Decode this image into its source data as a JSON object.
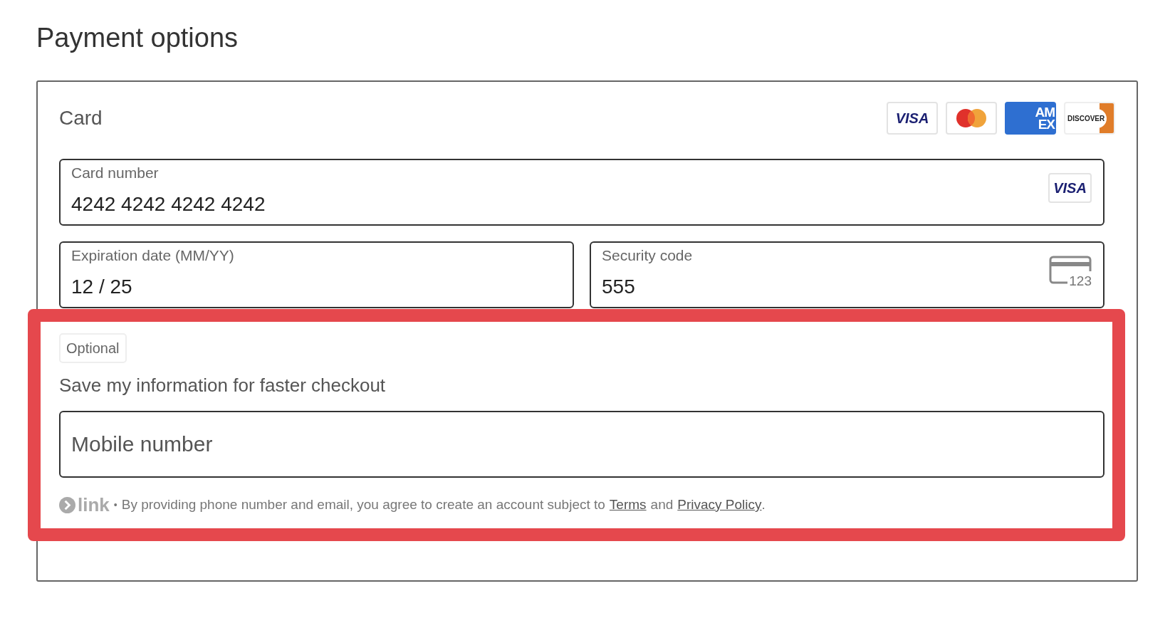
{
  "heading": "Payment options",
  "section_title": "Card",
  "brand_logos": [
    {
      "kind": "visa",
      "lines": [
        "VISA"
      ]
    },
    {
      "kind": "mastercard"
    },
    {
      "kind": "amex",
      "lines": [
        "AM",
        "EX"
      ]
    },
    {
      "kind": "discover",
      "lines": [
        "DISCOVER"
      ]
    }
  ],
  "card_number": {
    "label": "Card number",
    "value": "4242 4242 4242 4242",
    "brand": {
      "kind": "visa",
      "lines": [
        "VISA"
      ]
    }
  },
  "expiration": {
    "label": "Expiration date (MM/YY)",
    "value": "12 / 25"
  },
  "security_code": {
    "label": "Security code",
    "value": "555",
    "icon_text": "123"
  },
  "highlighted": true,
  "save_section": {
    "badge": "Optional",
    "text": "Save my information for faster checkout",
    "mobile": {
      "placeholder": "Mobile number"
    },
    "footer": {
      "logo_text": "link",
      "separator": "•",
      "text": "By providing phone number and email, you agree to create an account subject to",
      "terms_link": "Terms",
      "and": "and",
      "privacy_link": "Privacy Policy",
      "end": "."
    }
  }
}
